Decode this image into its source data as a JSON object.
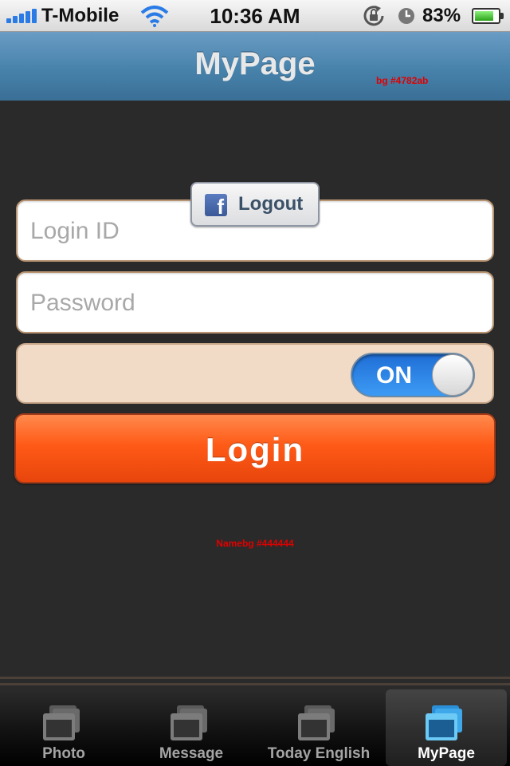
{
  "status_bar": {
    "carrier": "T-Mobile",
    "time": "10:36 AM",
    "battery_percent": "83%",
    "battery_level": 0.83,
    "icons": [
      "signal-icon",
      "wifi-icon",
      "rotation-lock-icon",
      "alarm-icon",
      "battery-icon"
    ]
  },
  "nav": {
    "title": "MyPage",
    "annotation": "bg #4782ab"
  },
  "login_form": {
    "login_id_placeholder": "Login ID",
    "password_placeholder": "Password",
    "facebook_button_label": "Logout",
    "facebook_icon": "facebook-icon",
    "toggle_label": "ON",
    "toggle_on": true,
    "login_button_label": "Login"
  },
  "body_annotation": "Namebg #444444",
  "tab_bar": {
    "tabs": [
      {
        "label": "Photo",
        "icon": "windows-icon",
        "selected": false
      },
      {
        "label": "Message",
        "icon": "windows-icon",
        "selected": false
      },
      {
        "label": "Today English",
        "icon": "windows-icon",
        "selected": false
      },
      {
        "label": "MyPage",
        "icon": "windows-icon",
        "selected": true
      }
    ]
  },
  "colors": {
    "nav_bg": "#4782ab",
    "body_bg": "#2a2a2a",
    "toggle_row_bg": "#f1dac6",
    "login_button": "#ff5a17",
    "annotation_text": "#e00000"
  }
}
